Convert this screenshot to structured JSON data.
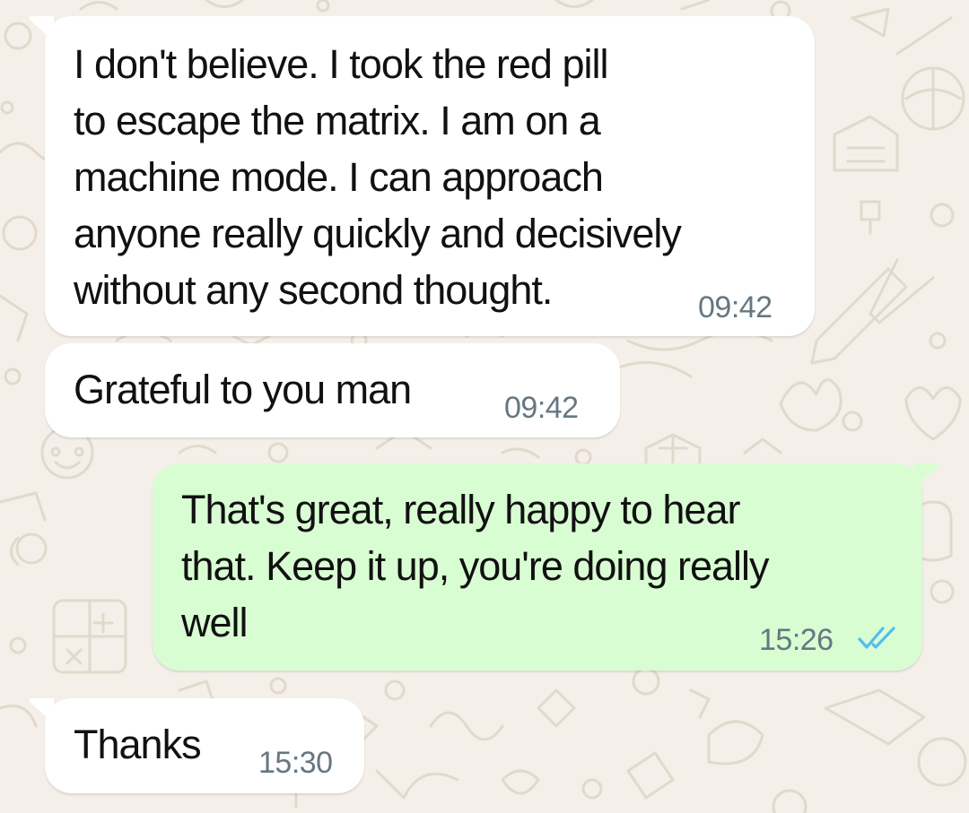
{
  "theme": {
    "wallpaper_color": "#f4efe8",
    "doodle_color": "#e2d9cc",
    "incoming_bubble": "#ffffff",
    "outgoing_bubble": "#d9fdd3",
    "timestamp_color": "#667781",
    "read_receipt_color": "#53bdeb"
  },
  "messages": [
    {
      "direction": "incoming",
      "text": "I don't believe. I took the red pill\nto escape the matrix. I am on a\nmachine mode. I can approach\nanyone really quickly and decisively\nwithout any second thought.",
      "time": "09:42"
    },
    {
      "direction": "incoming",
      "text": "Grateful to you man",
      "time": "09:42"
    },
    {
      "direction": "outgoing",
      "text": "That's great, really happy to hear\nthat. Keep it up, you're doing really\nwell",
      "time": "15:26",
      "status_icon": "double-check-read-icon"
    },
    {
      "direction": "incoming",
      "text": "Thanks",
      "time": "15:30"
    }
  ]
}
